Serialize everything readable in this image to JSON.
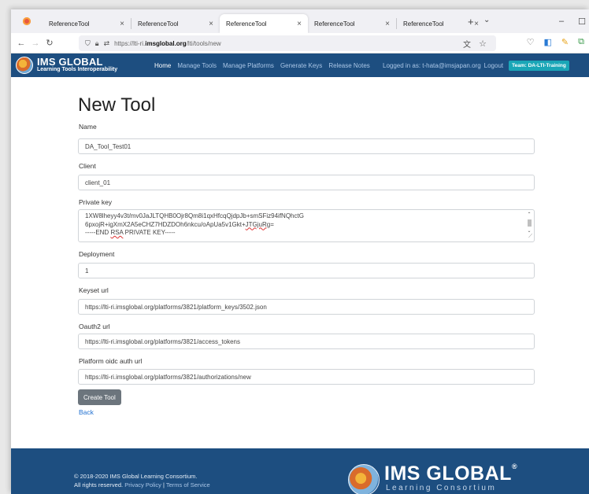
{
  "browser": {
    "tabs": [
      {
        "title": "ReferenceTool",
        "active": false
      },
      {
        "title": "ReferenceTool",
        "active": false
      },
      {
        "title": "ReferenceTool",
        "active": true
      },
      {
        "title": "ReferenceTool",
        "active": false
      },
      {
        "title": "ReferenceTool",
        "active": false
      }
    ],
    "url_prefix": "https://lti-ri.",
    "url_host": "imsglobal.org",
    "url_path": "/lti/tools/new",
    "window_controls": [
      "minimize",
      "maximize"
    ]
  },
  "header": {
    "brand_line1": "IMS GLOBAL",
    "brand_line2": "Learning Tools Interoperability",
    "menu": [
      "Home",
      "Manage Tools",
      "Manage Platforms",
      "Generate Keys",
      "Release Notes"
    ],
    "logged_in": "Logged in as: t-hata@imsjapan.org",
    "logout": "Logout",
    "team": "Team: DA-LTI-Training"
  },
  "form": {
    "title": "New Tool",
    "name_label": "Name",
    "name_value": "DA_Tool_Test01",
    "client_label": "Client",
    "client_value": "client_01",
    "private_key_label": "Private key",
    "private_key_lines": [
      "1XW8lheyy4v3t/mv0JaJLTQHB0Ojr8Qm8i1qxHfcqQjdpJb+smSFiz94ifNQhctG",
      "6pxojR+igXmX2A5eCHZ7HDZDOh6nkcu/oApUa5v1Gkt+",
      "-----END ",
      " PRIVATE KEY-----"
    ],
    "private_key_misspelled_1": "JTGjuRg",
    "private_key_misspelled_2": "RSA",
    "private_key_tail_1": "=",
    "deployment_label": "Deployment",
    "deployment_value": "1",
    "keyset_label": "Keyset url",
    "keyset_value": "https://lti-ri.imsglobal.org/platforms/3821/platform_keys/3502.json",
    "oauth2_label": "Oauth2 url",
    "oauth2_value": "https://lti-ri.imsglobal.org/platforms/3821/access_tokens",
    "oidc_label": "Platform oidc auth url",
    "oidc_value": "https://lti-ri.imsglobal.org/platforms/3821/authorizations/new",
    "submit_label": "Create Tool",
    "back_label": "Back"
  },
  "footer": {
    "copyright": "© 2018-2020 IMS Global Learning Consortium.",
    "rights": "All rights reserved. ",
    "privacy": "Privacy Policy",
    "sep": " | ",
    "terms": "Terms of Service",
    "logo_text": "IMS GLOBAL",
    "logo_reg": "®",
    "logo_sub": "Learning Consortium"
  },
  "colors": {
    "header_bg": "#1d4e80",
    "team_badge": "#1aa6b7",
    "button_gray": "#6c757d",
    "link_blue": "#1f6fd0"
  }
}
